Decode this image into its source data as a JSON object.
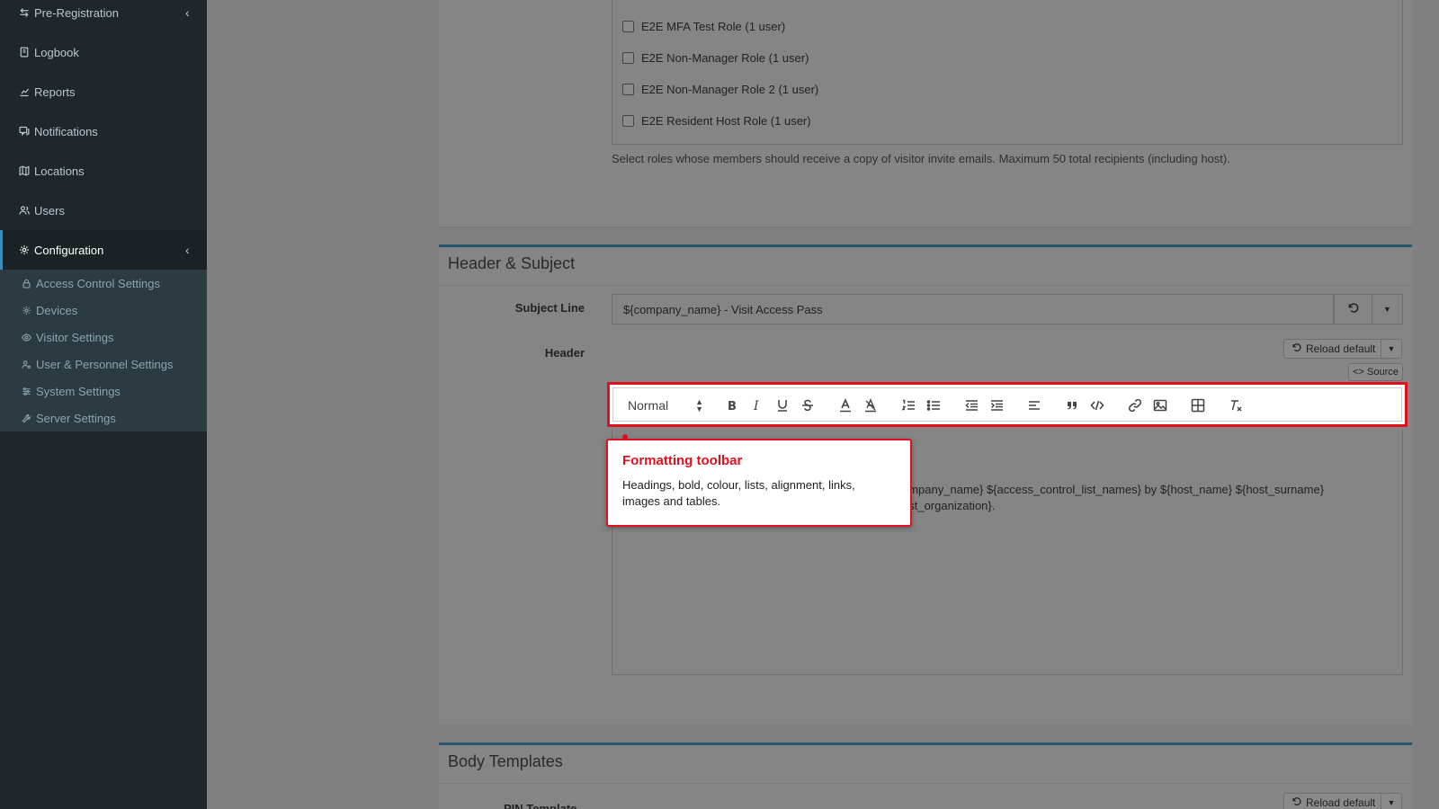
{
  "sidebar": {
    "items": [
      {
        "label": "Pre-Registration",
        "icon": "swap-arrows-icon"
      },
      {
        "label": "Logbook",
        "icon": "book-icon"
      },
      {
        "label": "Reports",
        "icon": "chart-icon"
      },
      {
        "label": "Notifications",
        "icon": "chat-icon"
      },
      {
        "label": "Locations",
        "icon": "map-icon"
      },
      {
        "label": "Users",
        "icon": "users-icon"
      },
      {
        "label": "Configuration",
        "icon": "gear-icon"
      }
    ],
    "submenu": [
      {
        "label": "Access Control Settings",
        "icon": "lock-icon"
      },
      {
        "label": "Devices",
        "icon": "cog-icon"
      },
      {
        "label": "Visitor Settings",
        "icon": "eye-icon"
      },
      {
        "label": "User & Personnel Settings",
        "icon": "user-cog-icon"
      },
      {
        "label": "System Settings",
        "icon": "sliders-icon"
      },
      {
        "label": "Server Settings",
        "icon": "wrench-icon"
      }
    ]
  },
  "roles": {
    "items": [
      "E2E MFA Test Role (1 user)",
      "E2E Non-Manager Role (1 user)",
      "E2E Non-Manager Role 2 (1 user)",
      "E2E Resident Host Role (1 user)"
    ],
    "help": "Select roles whose members should receive a copy of visitor invite emails. Maximum 50 total recipients (including host)."
  },
  "header_subject": {
    "title": "Header & Subject",
    "subject_label": "Subject Line",
    "subject_value": "${company_name} - Visit Access Pass",
    "header_label": "Header",
    "reload_default": "Reload default",
    "source": "<> Source",
    "toolbar": {
      "format_value": "Normal"
    },
    "editor_text_line1": "ompany_name} ${access_control_list_names} by ${host_name} ${host_surname}",
    "editor_text_line2": "ost_organization}."
  },
  "callout": {
    "title": "Formatting toolbar",
    "body": "Headings, bold, colour, lists, alignment, links, images and tables."
  },
  "body_templates": {
    "title": "Body Templates",
    "pin_label": "PIN Template",
    "reload_default": "Reload default"
  },
  "colors": {
    "highlight": "#e0101e",
    "sidebar_bg": "#1f272c",
    "accent": "#3c8dbc"
  }
}
